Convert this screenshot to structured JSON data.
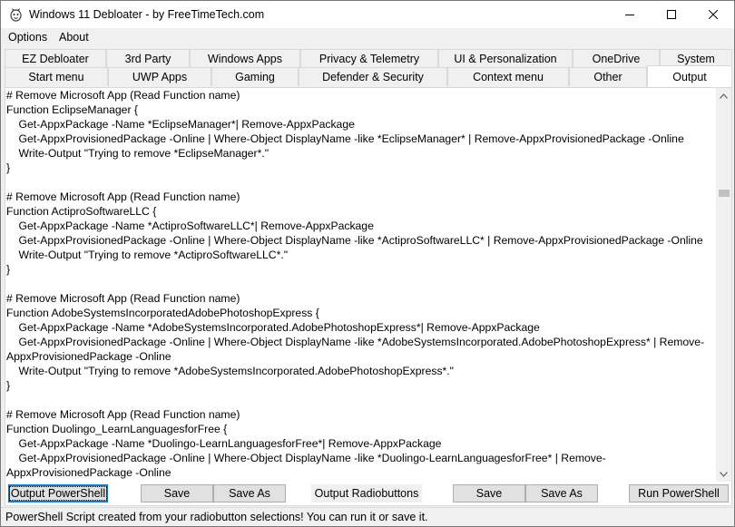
{
  "window": {
    "title": "Windows 11 Debloater - by FreeTimeTech.com",
    "icon": "app-icon"
  },
  "menu": [
    "Options",
    "About"
  ],
  "tabs_row1": [
    "EZ Debloater",
    "3rd Party",
    "Windows Apps",
    "Privacy & Telemetry",
    "UI & Personalization",
    "OneDrive",
    "System"
  ],
  "tabs_row2": [
    "Start menu",
    "UWP Apps",
    "Gaming",
    "Defender & Security",
    "Context menu",
    "Other",
    "Output"
  ],
  "active_tab": "Output",
  "output_text": "# Remove Microsoft App (Read Function name)\nFunction EclipseManager {\n    Get-AppxPackage -Name *EclipseManager*| Remove-AppxPackage\n    Get-AppxProvisionedPackage -Online | Where-Object DisplayName -like *EclipseManager* | Remove-AppxProvisionedPackage -Online\n    Write-Output \"Trying to remove *EclipseManager*.\"\n}\n\n# Remove Microsoft App (Read Function name)\nFunction ActiproSoftwareLLC {\n    Get-AppxPackage -Name *ActiproSoftwareLLC*| Remove-AppxPackage\n    Get-AppxProvisionedPackage -Online | Where-Object DisplayName -like *ActiproSoftwareLLC* | Remove-AppxProvisionedPackage -Online\n    Write-Output \"Trying to remove *ActiproSoftwareLLC*.\"\n}\n\n# Remove Microsoft App (Read Function name)\nFunction AdobeSystemsIncorporatedAdobePhotoshopExpress {\n    Get-AppxPackage -Name *AdobeSystemsIncorporated.AdobePhotoshopExpress*| Remove-AppxPackage\n    Get-AppxProvisionedPackage -Online | Where-Object DisplayName -like *AdobeSystemsIncorporated.AdobePhotoshopExpress* | Remove-AppxProvisionedPackage -Online\n    Write-Output \"Trying to remove *AdobeSystemsIncorporated.AdobePhotoshopExpress*.\"\n}\n\n# Remove Microsoft App (Read Function name)\nFunction Duolingo_LearnLanguagesforFree {\n    Get-AppxPackage -Name *Duolingo-LearnLanguagesforFree*| Remove-AppxPackage\n    Get-AppxProvisionedPackage -Online | Where-Object DisplayName -like *Duolingo-LearnLanguagesforFree* | Remove-AppxProvisionedPackage -Online\n    Write-Output \"Trying to remove *Duolingo-LearnLanguagesforFree*.\"\n}",
  "buttons": {
    "output_powershell": "Output PowerShell",
    "save1": "Save",
    "save_as1": "Save As",
    "output_radiobuttons": "Output Radiobuttons",
    "save2": "Save",
    "save_as2": "Save As",
    "run_powershell": "Run PowerShell"
  },
  "status": "PowerShell Script created from your radiobutton selections! You can run it or save it.",
  "colors": {
    "window_bg": "#f0f0f0",
    "text_bg": "#ffffff",
    "focus_border": "#0078d7",
    "button_bg": "#e1e1e1"
  }
}
